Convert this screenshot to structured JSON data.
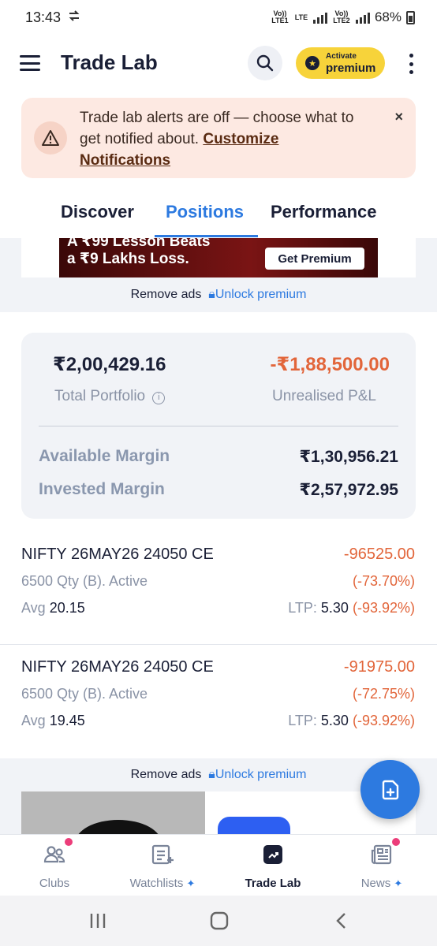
{
  "status_bar": {
    "time": "13:43",
    "sim1": "Vo)) LTE1",
    "net1": "LTE",
    "sim2": "Vo)) LTE2",
    "battery": "68%"
  },
  "app_bar": {
    "title": "Trade Lab",
    "premium_small": "Activate",
    "premium_big": "premium"
  },
  "alert": {
    "text": "Trade lab alerts are off — choose what to get notified about. ",
    "link": "Customize Notifications",
    "close": "×"
  },
  "tabs": [
    {
      "label": "Discover",
      "active": false
    },
    {
      "label": "Positions",
      "active": true
    },
    {
      "label": "Performance",
      "active": false
    }
  ],
  "ad_top": {
    "line1": "A ₹99 Lesson Beats",
    "line2": "a ₹9 Lakhs Loss.",
    "cta": "Get Premium"
  },
  "remove_ads": {
    "text": "Remove ads",
    "unlock": "Unlock premium"
  },
  "portfolio": {
    "total_value": "₹2,00,429.16",
    "total_label": "Total Portfolio",
    "pnl_value": "-₹1,88,500.00",
    "pnl_label": "Unrealised P&L",
    "available_margin_label": "Available Margin",
    "available_margin_value": "₹1,30,956.21",
    "invested_margin_label": "Invested Margin",
    "invested_margin_value": "₹2,57,972.95"
  },
  "positions": [
    {
      "name": "NIFTY 26MAY26 24050 CE",
      "pnl": "-96525.00",
      "qty": "6500 Qty (B). Active",
      "pnl_pct": "(-73.70%)",
      "avg_label": "Avg",
      "avg_value": "20.15",
      "ltp_label": "LTP:",
      "ltp_value": "5.30",
      "ltp_pct": "(-93.92%)"
    },
    {
      "name": "NIFTY 26MAY26 24050 CE",
      "pnl": "-91975.00",
      "qty": "6500 Qty (B). Active",
      "pnl_pct": "(-72.75%)",
      "avg_label": "Avg",
      "avg_value": "19.45",
      "ltp_label": "LTP:",
      "ltp_value": "5.30",
      "ltp_pct": "(-93.92%)"
    }
  ],
  "bottom_nav": [
    {
      "label": "Clubs",
      "icon": "clubs-icon",
      "badge": true,
      "plus": false,
      "active": false
    },
    {
      "label": "Watchlists",
      "icon": "watchlist-icon",
      "badge": false,
      "plus": true,
      "active": false
    },
    {
      "label": "Trade Lab",
      "icon": "trade-lab-icon",
      "badge": false,
      "plus": false,
      "active": true
    },
    {
      "label": "News",
      "icon": "news-icon",
      "badge": true,
      "plus": true,
      "active": false
    }
  ],
  "colors": {
    "accent": "#2d7ae0",
    "loss": "#e2653a",
    "premium": "#f7d33a",
    "alert_bg": "#fde9e2"
  }
}
